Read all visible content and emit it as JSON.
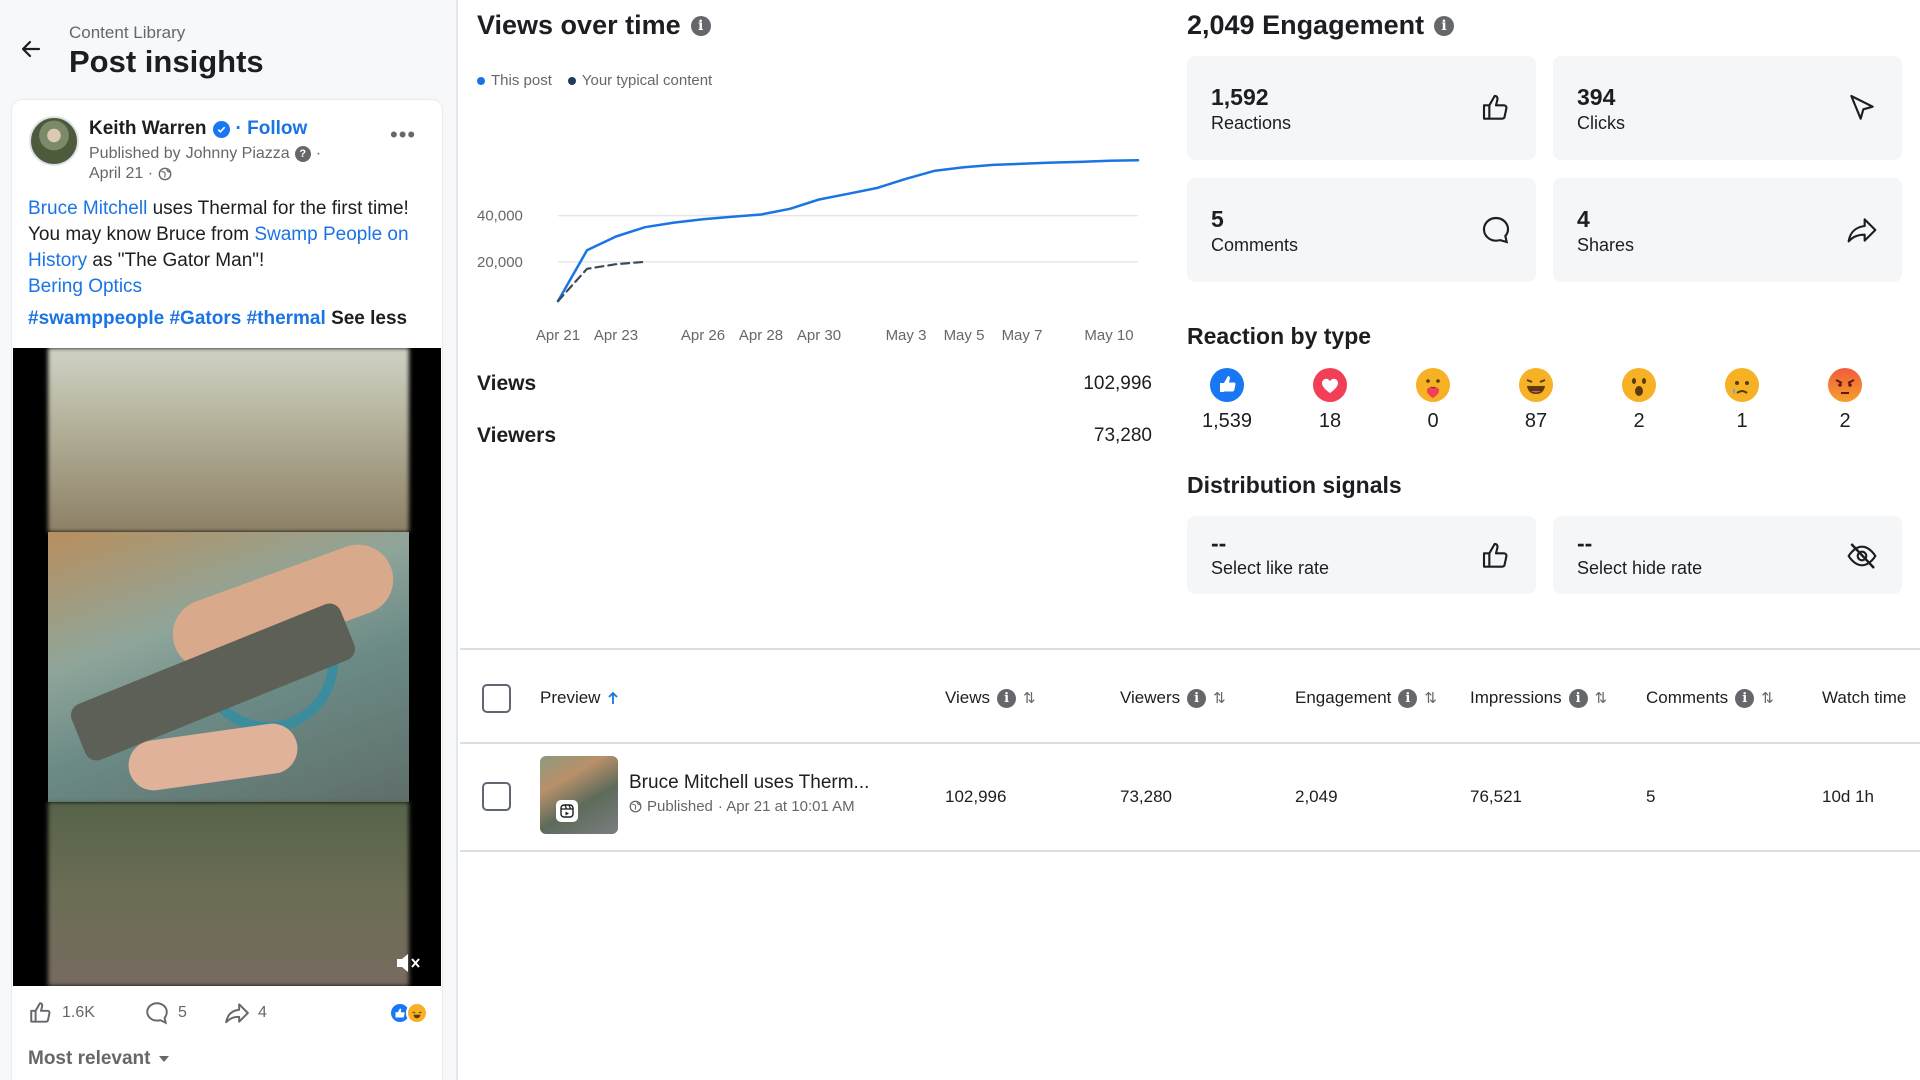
{
  "header": {
    "breadcrumb": "Content Library",
    "title": "Post insights"
  },
  "post": {
    "author": "Keith Warren",
    "follow_label": "Follow",
    "published_prefix": "Published by",
    "publisher": "Johnny Piazza",
    "date": "April 21 ·",
    "text": {
      "mention": "Bruce Mitchell",
      "part1": " uses Thermal for the first time! You may know Bruce from ",
      "show_link": "Swamp People on History",
      "part2": " as \"The Gator Man\"!",
      "brand_link": "Bering Optics"
    },
    "hashtags": "#swamppeople #Gators #thermal",
    "see_less": "See less",
    "likes": "1.6K",
    "comments": "5",
    "shares": "4",
    "comment_filter": "Most relevant"
  },
  "views_over_time": {
    "title": "Views over time",
    "legend": {
      "this_post": "This post",
      "typical": "Your typical content"
    },
    "colors": {
      "this_post": "#1b74e4",
      "typical": "#3a4a5c",
      "grid": "#dadde1"
    }
  },
  "chart_data": {
    "type": "line",
    "x": [
      "Apr 21",
      "Apr 22",
      "Apr 23",
      "Apr 24",
      "Apr 25",
      "Apr 26",
      "Apr 27",
      "Apr 28",
      "Apr 29",
      "Apr 30",
      "May 1",
      "May 2",
      "May 3",
      "May 4",
      "May 5",
      "May 6",
      "May 7",
      "May 8",
      "May 9",
      "May 10",
      "May 11"
    ],
    "x_tick_labels": [
      "Apr 21",
      "Apr 23",
      "Apr 26",
      "Apr 28",
      "Apr 30",
      "May 3",
      "May 5",
      "May 7",
      "May 10"
    ],
    "series": [
      {
        "name": "This post",
        "values": [
          3000,
          25000,
          31000,
          35000,
          37000,
          38500,
          39500,
          40500,
          43000,
          47000,
          49500,
          52000,
          56000,
          59500,
          61000,
          62000,
          62500,
          63000,
          63300,
          63800,
          64000
        ]
      },
      {
        "name": "Your typical content",
        "values": [
          3000,
          17000,
          19000,
          20000,
          null,
          null,
          null,
          null,
          null,
          null,
          null,
          null,
          null,
          null,
          null,
          null,
          null,
          null,
          null,
          null,
          null
        ]
      }
    ],
    "y_ticks": [
      20000,
      40000
    ],
    "y_tick_labels": [
      "20,000",
      "40,000"
    ],
    "ylim": [
      0,
      65000
    ],
    "grid": true,
    "legend_position": "top-left"
  },
  "totals": [
    {
      "label": "Views",
      "value": "102,996"
    },
    {
      "label": "Viewers",
      "value": "73,280"
    }
  ],
  "engagement": {
    "title": "2,049 Engagement",
    "tiles": [
      {
        "number": "1,592",
        "label": "Reactions",
        "icon": "thumbs-up-icon"
      },
      {
        "number": "394",
        "label": "Clicks",
        "icon": "cursor-icon"
      },
      {
        "number": "5",
        "label": "Comments",
        "icon": "comment-icon"
      },
      {
        "number": "4",
        "label": "Shares",
        "icon": "share-icon"
      }
    ]
  },
  "reactions": {
    "title": "Reaction by type",
    "items": [
      {
        "type": "like",
        "count": "1,539",
        "color": "#1877f2"
      },
      {
        "type": "love",
        "count": "18",
        "color": "#f33e58"
      },
      {
        "type": "care",
        "count": "0",
        "color": "#f7b125"
      },
      {
        "type": "haha",
        "count": "87",
        "color": "#f7b125"
      },
      {
        "type": "wow",
        "count": "2",
        "color": "#f7b125"
      },
      {
        "type": "sad",
        "count": "1",
        "color": "#f7b125"
      },
      {
        "type": "angry",
        "count": "2",
        "color": "#e9710f"
      }
    ]
  },
  "distribution": {
    "title": "Distribution signals",
    "tiles": [
      {
        "value": "--",
        "label": "Select like rate",
        "icon": "thumbs-up-icon"
      },
      {
        "value": "--",
        "label": "Select hide rate",
        "icon": "eye-off-icon"
      }
    ]
  },
  "table": {
    "columns": [
      "Preview",
      "Views",
      "Viewers",
      "Engagement",
      "Impressions",
      "Comments",
      "Watch time"
    ],
    "rows": [
      {
        "title": "Bruce Mitchell uses Therm...",
        "status": "Published",
        "published_at": "· Apr 21 at 10:01 AM",
        "views": "102,996",
        "viewers": "73,280",
        "engagement": "2,049",
        "impressions": "76,521",
        "comments": "5",
        "watch_time": "10d 1h"
      }
    ]
  }
}
